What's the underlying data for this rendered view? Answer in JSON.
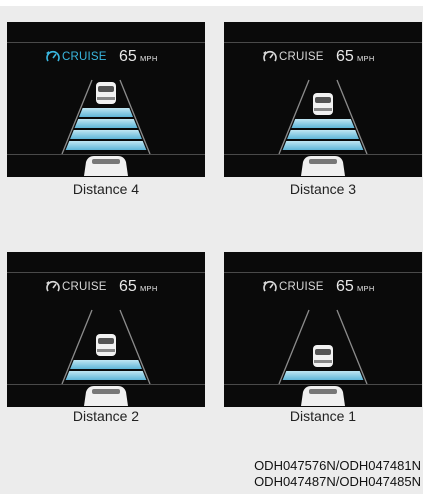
{
  "panels": [
    {
      "caption": "Distance 4",
      "distance": 4,
      "cruise_label": "CRUISE",
      "speed": "65",
      "unit": "MPH",
      "cruise_color": "#3ab7e0"
    },
    {
      "caption": "Distance 3",
      "distance": 3,
      "cruise_label": "CRUISE",
      "speed": "65",
      "unit": "MPH",
      "cruise_color": "#d8d8d8"
    },
    {
      "caption": "Distance 2",
      "distance": 2,
      "cruise_label": "CRUISE",
      "speed": "65",
      "unit": "MPH",
      "cruise_color": "#d8d8d8"
    },
    {
      "caption": "Distance 1",
      "distance": 1,
      "cruise_label": "CRUISE",
      "speed": "65",
      "unit": "MPH",
      "cruise_color": "#d8d8d8"
    }
  ],
  "codes": {
    "line1": "ODH047576N/ODH047481N",
    "line2": "ODH047487N/ODH047485N"
  },
  "colors": {
    "gap_bar": "#bfe6f2",
    "gap_dark": "#5fb6d8",
    "lane": "#8c8c8c"
  },
  "icons": [
    "cruise-control-icon",
    "lead-car-icon",
    "own-car-icon"
  ]
}
